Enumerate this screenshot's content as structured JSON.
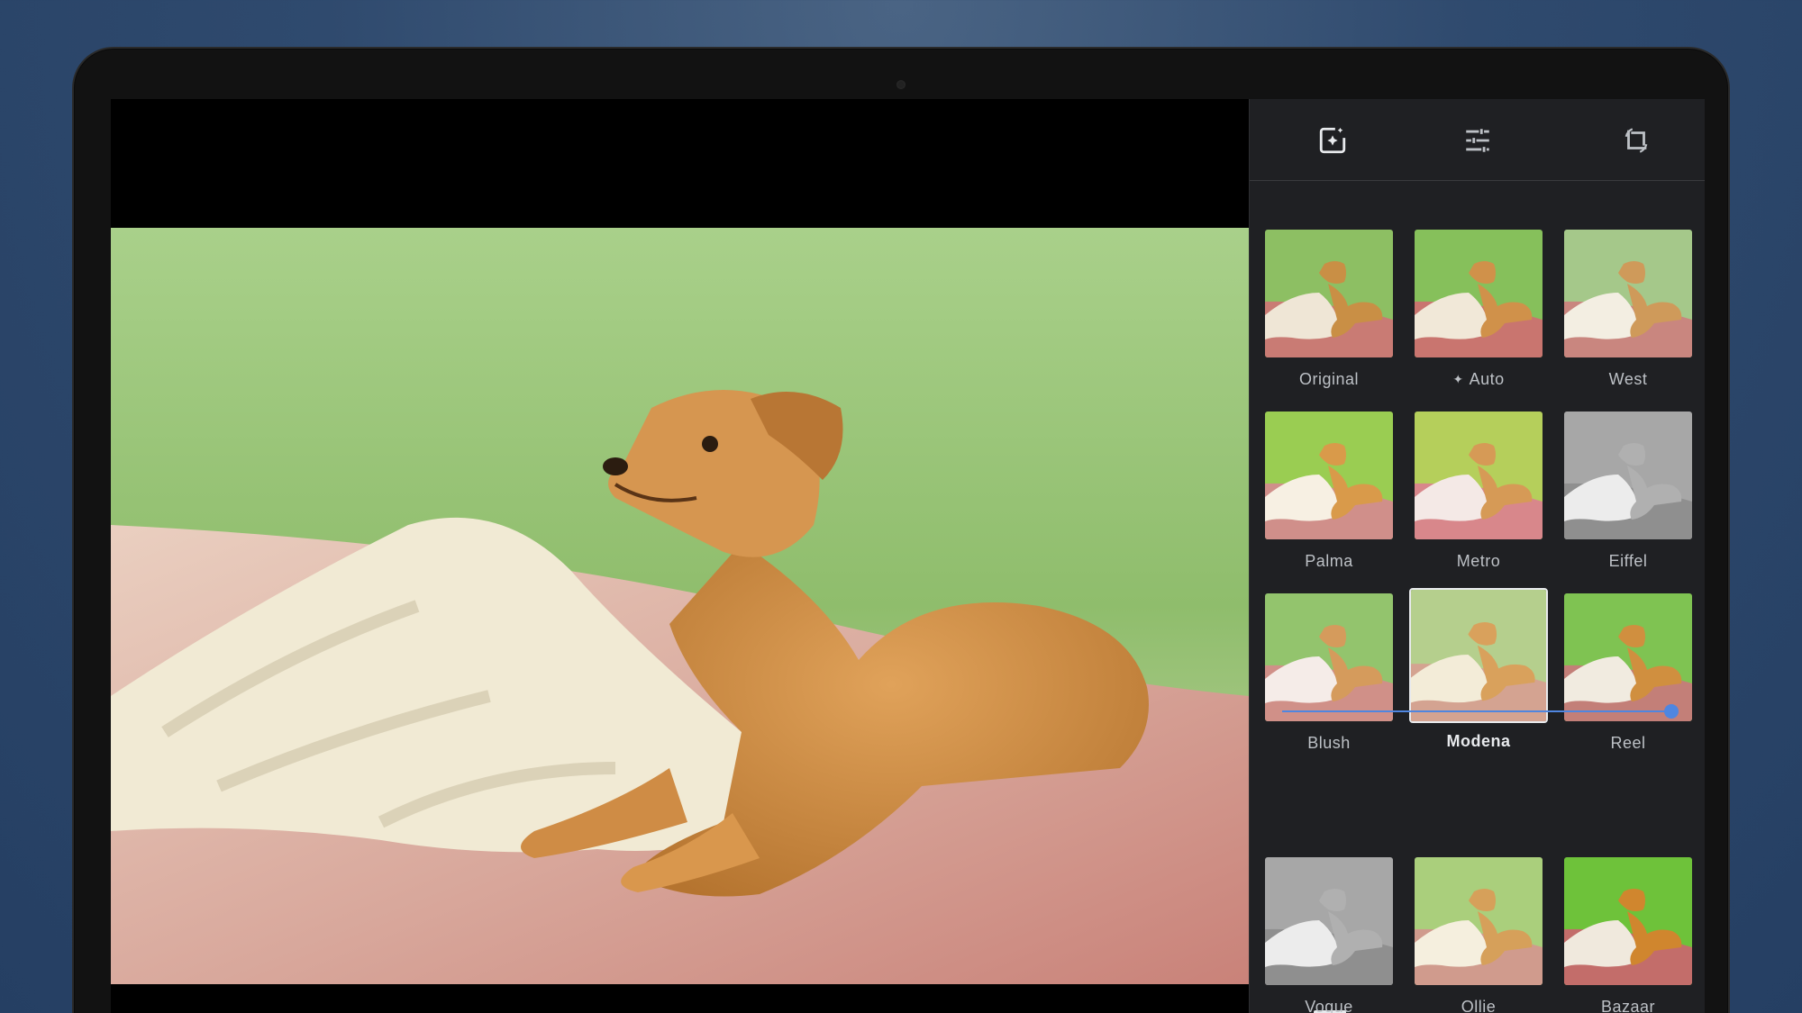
{
  "tabs": [
    {
      "name": "filters",
      "icon": "photo-sparkle-icon",
      "active": true
    },
    {
      "name": "adjust",
      "icon": "sliders-icon",
      "active": false
    },
    {
      "name": "crop",
      "icon": "crop-rotate-icon",
      "active": false
    }
  ],
  "filters": [
    {
      "label": "Original",
      "tone": "original"
    },
    {
      "label": "Auto",
      "tone": "auto",
      "icon": "sparkle-icon"
    },
    {
      "label": "West",
      "tone": "west"
    },
    {
      "label": "Palma",
      "tone": "palma"
    },
    {
      "label": "Metro",
      "tone": "metro"
    },
    {
      "label": "Eiffel",
      "tone": "bw"
    },
    {
      "label": "Blush",
      "tone": "blush"
    },
    {
      "label": "Modena",
      "tone": "modena",
      "selected": true
    },
    {
      "label": "Reel",
      "tone": "reel"
    },
    {
      "label": "Vogue",
      "tone": "bw"
    },
    {
      "label": "Ollie",
      "tone": "ollie"
    },
    {
      "label": "Bazaar",
      "tone": "bazaar"
    }
  ],
  "intensity": {
    "value": 1.0
  },
  "colors": {
    "accent": "#4f86e0",
    "panel": "#1f2023",
    "text": "#bdc1c6"
  }
}
